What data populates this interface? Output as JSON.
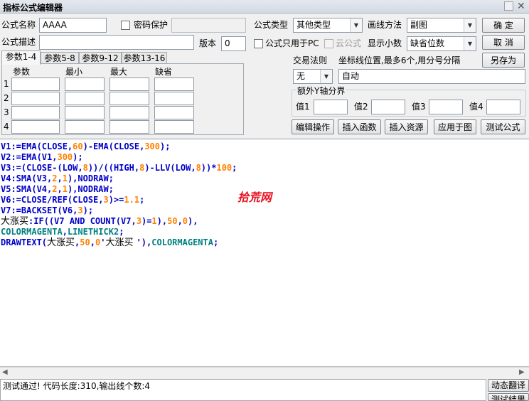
{
  "window": {
    "title": "指标公式编辑器"
  },
  "form": {
    "name_label": "公式名称",
    "name_value": "AAAA",
    "password_label": "密码保护",
    "desc_label": "公式描述",
    "desc_value": "",
    "version_label": "版本",
    "version_value": "0",
    "type_label": "公式类型",
    "type_value": "其他类型",
    "draw_label": "画线方法",
    "draw_value": "副图",
    "pc_only_label": "公式只用于PC",
    "cloud_label": "云公式",
    "decimals_label": "显示小数",
    "decimals_value": "缺省位数",
    "trade_rule_label": "交易法则",
    "trade_rule_value": "无",
    "coord_label": "坐标线位置,最多6个,用分号分隔",
    "coord_value": "自动",
    "yaxis_group_label": "额外Y轴分界",
    "yaxis": [
      {
        "label": "值1",
        "value": ""
      },
      {
        "label": "值2",
        "value": ""
      },
      {
        "label": "值3",
        "value": ""
      },
      {
        "label": "值4",
        "value": ""
      }
    ]
  },
  "buttons": {
    "ok": "确  定",
    "cancel": "取  消",
    "save_as": "另存为",
    "edit_ops": "编辑操作",
    "insert_func": "插入函数",
    "insert_res": "插入资源",
    "apply_chart": "应用于图",
    "test_formula": "测试公式",
    "dynamic_translate": "动态翻译",
    "test_result": "测试结果"
  },
  "param_tabs": [
    "参数1-4",
    "参数5-8",
    "参数9-12",
    "参数13-16"
  ],
  "param_headers": [
    "参数",
    "最小",
    "最大",
    "缺省"
  ],
  "param_rows": [
    "1",
    "2",
    "3",
    "4"
  ],
  "code_lines": [
    "V1:=EMA(CLOSE,60)-EMA(CLOSE,300);",
    "V2:=EMA(V1,300);",
    "V3:=(CLOSE-(LOW,8))/((HIGH,8)-LLV(LOW,8))*100;",
    "V4:SMA(V3,2,1),NODRAW;",
    "V5:SMA(V4,2,1),NODRAW;",
    "V6:=CLOSE/REF(CLOSE,3)>=1.1;",
    "V7:=BACKSET(V6,3);",
    "大涨买:IF((V7 AND COUNT(V7,3)=1),50,0),",
    "COLORMAGENTA,LINETHICK2;",
    "DRAWTEXT(大涨买,50,0'大涨买 '),COLORMAGENTA;"
  ],
  "watermark": "拾荒网",
  "status": "测试通过! 代码长度:310,输出线个数:4"
}
